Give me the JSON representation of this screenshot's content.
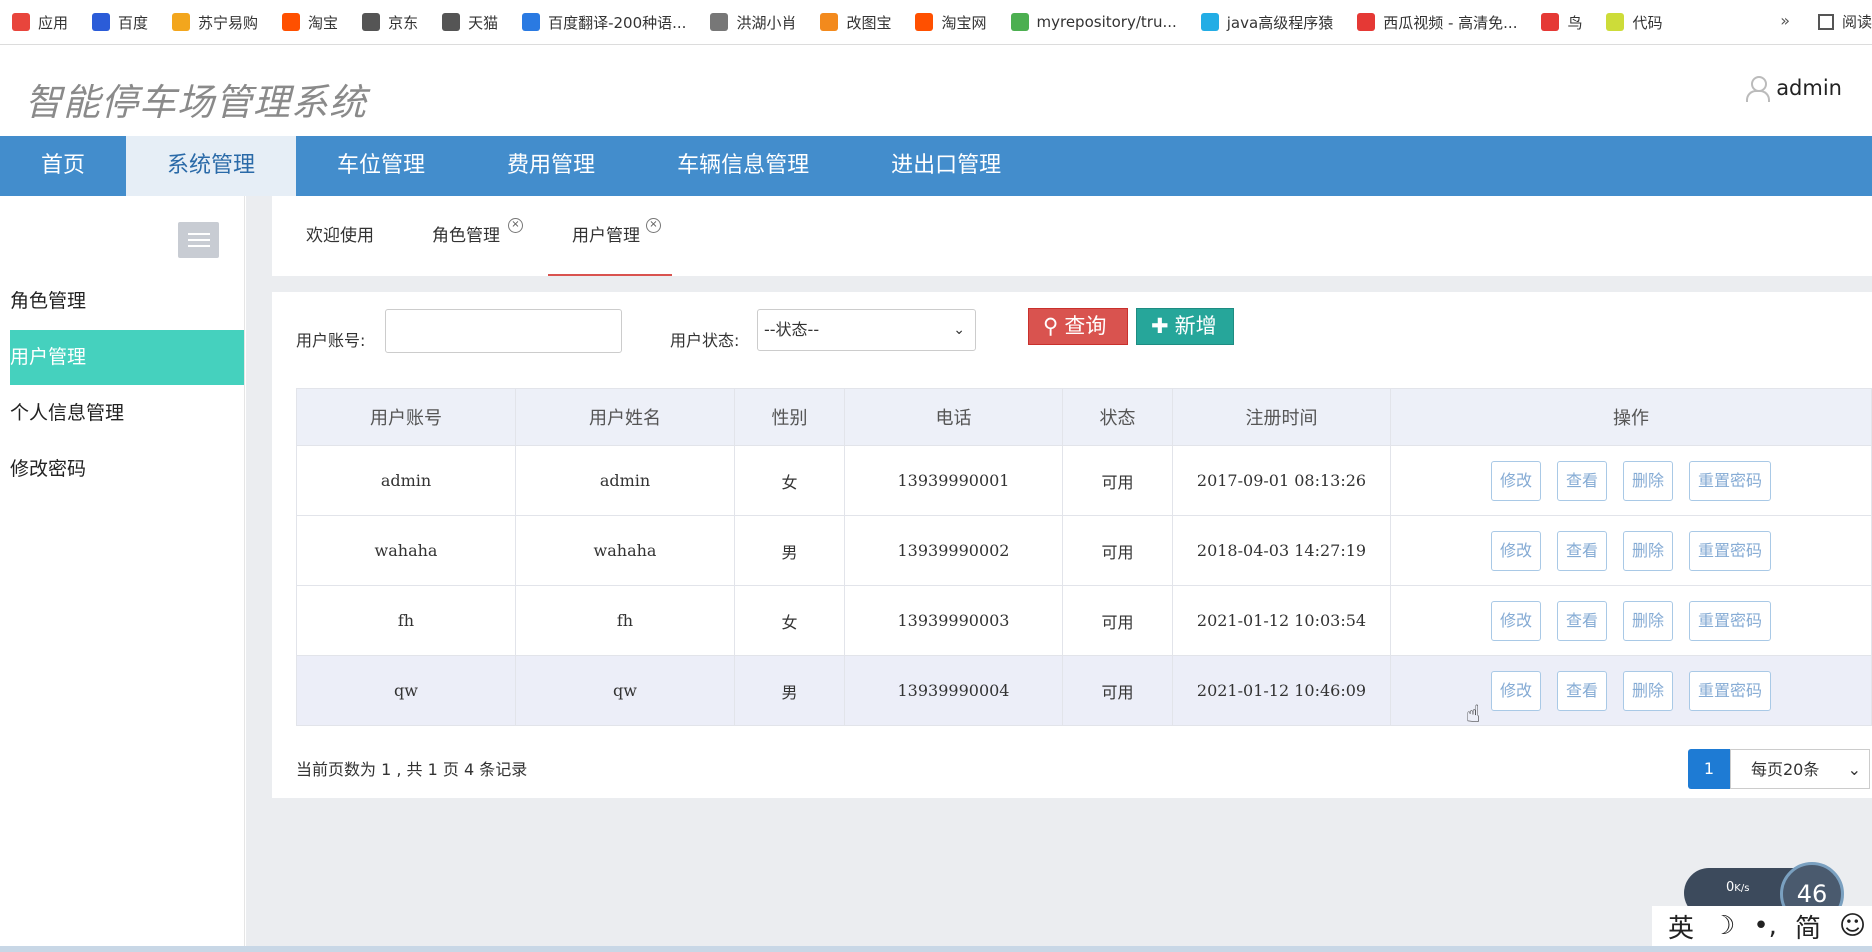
{
  "bookmarks": [
    {
      "label": "应用",
      "icon": "apps-grid-icon",
      "color": "#e8453c"
    },
    {
      "label": "百度",
      "icon": "baidu-paw-icon",
      "color": "#2b5cd8"
    },
    {
      "label": "苏宁易购",
      "icon": "suning-icon",
      "color": "#f3a61d"
    },
    {
      "label": "淘宝",
      "icon": "taobao-icon",
      "color": "#ff5000"
    },
    {
      "label": "京东",
      "icon": "globe-icon",
      "color": "#555555"
    },
    {
      "label": "天猫",
      "icon": "globe-icon",
      "color": "#555555"
    },
    {
      "label": "百度翻译-200种语...",
      "icon": "translate-icon",
      "color": "#2a7ae2"
    },
    {
      "label": "洪湖小肖",
      "icon": "feather-icon",
      "color": "#777777"
    },
    {
      "label": "改图宝",
      "icon": "gaitubao-icon",
      "color": "#f38a1d"
    },
    {
      "label": "淘宝网",
      "icon": "taobao-icon",
      "color": "#ff5000"
    },
    {
      "label": "myrepository/tru...",
      "icon": "chrome-icon",
      "color": "#4caf50"
    },
    {
      "label": "java高级程序猿",
      "icon": "bilibili-icon",
      "color": "#23ade5"
    },
    {
      "label": "西瓜视频 - 高清免...",
      "icon": "xigua-icon",
      "color": "#e53935"
    },
    {
      "label": "鸟",
      "icon": "bird-icon",
      "color": "#e53935"
    },
    {
      "label": "代码",
      "icon": "code-icon",
      "color": "#cddc39"
    }
  ],
  "bookmarks_more": "»",
  "reading_list": "阅读",
  "app_title": "智能停车场管理系统",
  "username": "admin",
  "nav": [
    "首页",
    "系统管理",
    "车位管理",
    "费用管理",
    "车辆信息管理",
    "进出口管理"
  ],
  "sidebar": [
    "角色管理",
    "用户管理",
    "个人信息管理",
    "修改密码"
  ],
  "tabs": [
    "欢迎使用",
    "角色管理",
    "用户管理"
  ],
  "tab_close_glyph": "×",
  "search": {
    "account_label": "用户账号:",
    "account_value": "",
    "status_label": "用户状态:",
    "status_selected": "--状态--",
    "query_label": "查询",
    "add_label": "新增"
  },
  "table": {
    "headers": [
      "用户账号",
      "用户姓名",
      "性别",
      "电话",
      "状态",
      "注册时间",
      "操作"
    ],
    "rows": [
      [
        "admin",
        "admin",
        "女",
        "13939990001",
        "可用",
        "2017-09-01 08:13:26"
      ],
      [
        "wahaha",
        "wahaha",
        "男",
        "13939990002",
        "可用",
        "2018-04-03 14:27:19"
      ],
      [
        "fh",
        "fh",
        "女",
        "13939990003",
        "可用",
        "2021-01-12 10:03:54"
      ],
      [
        "qw",
        "qw",
        "男",
        "13939990004",
        "可用",
        "2021-01-12 10:46:09"
      ]
    ],
    "actions": [
      "修改",
      "查看",
      "删除",
      "重置密码"
    ]
  },
  "pager": {
    "info": "当前页数为 1 , 共 1 页 4 条记录",
    "current_page": "1",
    "page_size": "每页20条"
  },
  "netmeter": {
    "rate": "0",
    "unit": "K/s",
    "percent": "46"
  },
  "ime": [
    "英",
    "☽",
    "•,",
    "简",
    "☺"
  ]
}
